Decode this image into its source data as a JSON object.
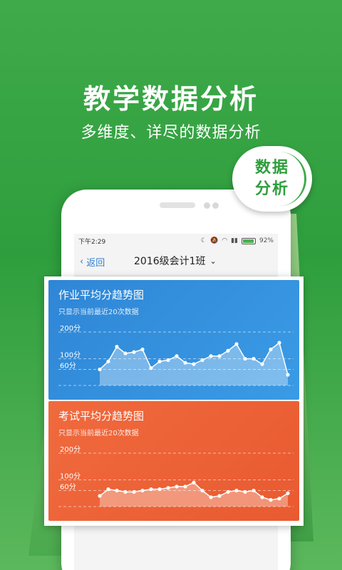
{
  "hero": {
    "title": "教学数据分析",
    "subtitle": "多维度、详尽的数据分析"
  },
  "badge": {
    "line1": "数据",
    "line2": "分析"
  },
  "statusbar": {
    "time": "下午2:29",
    "battery": "92%"
  },
  "navbar": {
    "back_label": "返回",
    "class_name": "2016级会计1班"
  },
  "charts": {
    "homework": {
      "title": "作业平均分趋势图",
      "subtitle": "只显示当前最近20次数据"
    },
    "exam": {
      "title": "考试平均分趋势图",
      "subtitle": "只显示当前最近20次数据"
    }
  },
  "colors": {
    "green": "#3faa4a",
    "blue": "#2f86d6",
    "orange": "#f06a3e",
    "link": "#2f7fd1"
  },
  "chart_data": [
    {
      "type": "area",
      "title": "作业平均分趋势图",
      "ylim": [
        0,
        240
      ],
      "y_ticks": [
        "200分",
        "100分",
        "60分"
      ],
      "y_tick_values": [
        200,
        100,
        60
      ],
      "values": [
        60,
        90,
        145,
        120,
        125,
        135,
        65,
        90,
        95,
        110,
        85,
        80,
        95,
        110,
        110,
        130,
        155,
        100,
        100,
        80,
        135,
        160,
        40
      ]
    },
    {
      "type": "area",
      "title": "考试平均分趋势图",
      "ylim": [
        0,
        240
      ],
      "y_ticks": [
        "200分",
        "100分",
        "60分"
      ],
      "y_tick_values": [
        200,
        100,
        60
      ],
      "values": [
        40,
        65,
        60,
        55,
        55,
        60,
        65,
        65,
        70,
        75,
        75,
        90,
        60,
        35,
        40,
        55,
        60,
        55,
        60,
        35,
        25,
        30,
        50
      ]
    }
  ]
}
